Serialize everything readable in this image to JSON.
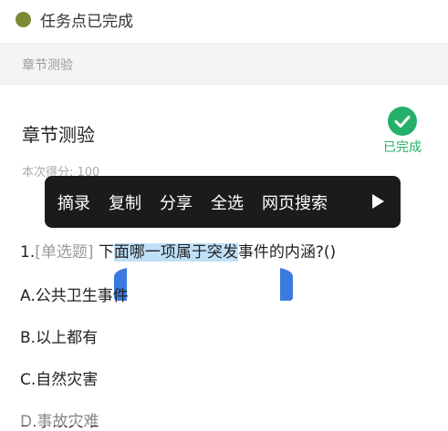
{
  "status": {
    "text": "任务点已完成"
  },
  "section": {
    "label": "章节测验"
  },
  "quiz": {
    "title": "章节测验",
    "score": "本次得分: 100",
    "status_label": "已完成"
  },
  "context_menu": {
    "items": [
      "摘录",
      "复制",
      "分享",
      "全选",
      "网页搜索"
    ]
  },
  "question": {
    "number": "1.",
    "type": "[单选题]",
    "text_before": " 下",
    "text_selected": "面哪一项属于突发",
    "text_after": "事件的内涵?()"
  },
  "options": {
    "a": "A.公共卫生事件",
    "b": "B.以上都有",
    "c": "C.自然灾害",
    "d": "D.事故灾难"
  },
  "colors": {
    "accent_green": "#25b06a",
    "status_dot": "#7c8a34",
    "selection_blue": "#3b7be0",
    "selection_highlight": "#bfe0f7",
    "menu_bg": "#1b1b1b"
  },
  "icons": {
    "status": "status-dot-icon",
    "done": "check-circle-icon",
    "more": "play-arrow-icon",
    "handles": "selection-handle-icon"
  }
}
